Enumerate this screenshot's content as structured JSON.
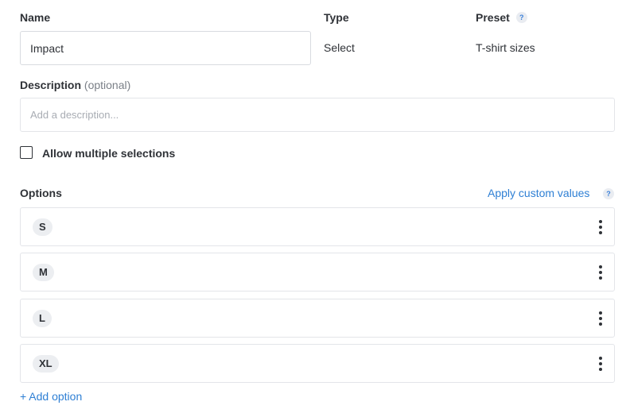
{
  "fields": {
    "name": {
      "label": "Name",
      "value": "Impact"
    },
    "type": {
      "label": "Type",
      "value": "Select"
    },
    "preset": {
      "label": "Preset",
      "help": "?",
      "value": "T-shirt sizes"
    },
    "description": {
      "label": "Description",
      "optional": "(optional)",
      "placeholder": "Add a description..."
    }
  },
  "multiple_selections": {
    "label": "Allow multiple selections",
    "checked": false
  },
  "options": {
    "label": "Options",
    "apply_custom": "Apply custom values",
    "help": "?",
    "items": [
      "S",
      "M",
      "L",
      "XL"
    ],
    "add_label": "+ Add option"
  },
  "colors": {
    "link": "#2e7fd4",
    "pill_bg": "#eceef1",
    "border": "#e3e5e9"
  }
}
